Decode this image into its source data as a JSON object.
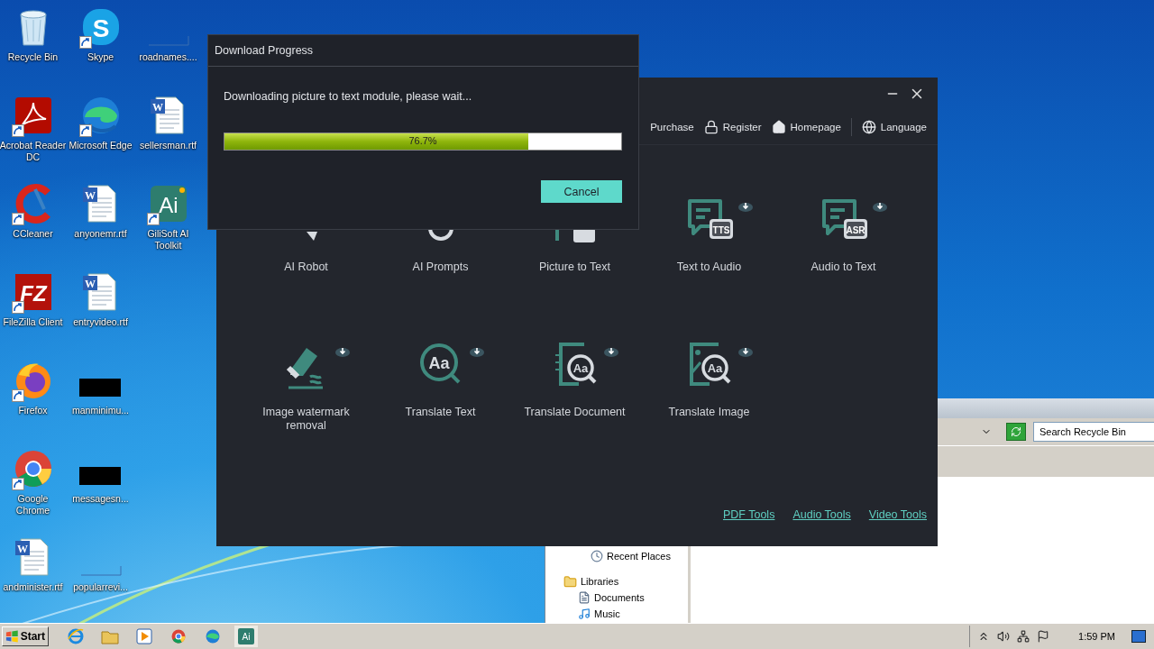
{
  "desktop": {
    "icons": [
      {
        "label": "Recycle Bin",
        "kind": "recycle",
        "shortcut": false
      },
      {
        "label": "Acrobat Reader DC",
        "kind": "acrobat",
        "shortcut": true
      },
      {
        "label": "CCleaner",
        "kind": "ccleaner",
        "shortcut": true
      },
      {
        "label": "FileZilla Client",
        "kind": "filezilla",
        "glyph": "FZ",
        "shortcut": true
      },
      {
        "label": "Firefox",
        "kind": "firefox",
        "shortcut": true
      },
      {
        "label": "Google Chrome",
        "kind": "chrome",
        "shortcut": true
      },
      {
        "label": "andminister.rtf",
        "kind": "word",
        "glyph": "W",
        "shortcut": false
      },
      {
        "label": "Skype",
        "kind": "skype",
        "glyph": "S",
        "shortcut": true
      },
      {
        "label": "Microsoft Edge",
        "kind": "edge",
        "shortcut": true
      },
      {
        "label": "anyonemr.rtf",
        "kind": "word",
        "glyph": "W",
        "shortcut": false
      },
      {
        "label": "entryvideo.rtf",
        "kind": "word",
        "glyph": "W",
        "shortcut": false
      },
      {
        "label": "manminimu...",
        "kind": "redacted",
        "shortcut": false
      },
      {
        "label": "messagesn...",
        "kind": "redacted",
        "shortcut": false
      },
      {
        "label": "popularrevi...",
        "kind": "blank",
        "shortcut": false
      },
      {
        "label": "roadnames....",
        "kind": "blank",
        "shortcut": false
      },
      {
        "label": "sellersman.rtf",
        "kind": "word",
        "glyph": "W",
        "shortcut": false
      },
      {
        "label": "GiliSoft AI Toolkit",
        "kind": "gilisoft",
        "glyph": "Ai",
        "shortcut": true
      }
    ]
  },
  "explorer": {
    "search": {
      "placeholder": "Search Recycle Bin"
    },
    "nav": [
      {
        "label": "Recent Places",
        "kind": "recent"
      },
      {
        "label": "Libraries",
        "kind": "library",
        "children": [
          {
            "label": "Documents",
            "kind": "document"
          },
          {
            "label": "Music",
            "kind": "music"
          }
        ]
      }
    ]
  },
  "app": {
    "nav": [
      {
        "label": "Purchase",
        "kind": "cart"
      },
      {
        "label": "Register",
        "kind": "lock"
      },
      {
        "label": "Homepage",
        "kind": "home"
      },
      {
        "label": "Language",
        "kind": "globe"
      }
    ],
    "tools": [
      {
        "label": "AI Robot",
        "kind": "robot",
        "download": false
      },
      {
        "label": "AI Prompts",
        "kind": "prompts",
        "download": false
      },
      {
        "label": "Picture to Text",
        "kind": "ocr",
        "download": false
      },
      {
        "label": "Text to Audio",
        "kind": "speech",
        "glyph": "TTS",
        "download": true
      },
      {
        "label": "Audio to Text",
        "kind": "speech",
        "glyph": "ASR",
        "download": true
      },
      {
        "label": "Image watermark removal",
        "kind": "eraser",
        "download": true
      },
      {
        "label": "Translate Text",
        "kind": "magnifier",
        "glyph": "Aa",
        "download": true
      },
      {
        "label": "Translate Document",
        "kind": "document",
        "glyph": "Aa",
        "download": true
      },
      {
        "label": "Translate Image",
        "kind": "image",
        "glyph": "Aa",
        "download": true
      }
    ],
    "links": [
      "PDF Tools",
      "Audio Tools",
      "Video Tools"
    ]
  },
  "dialog": {
    "title": "Download Progress",
    "message": "Downloading picture to text module, please wait...",
    "progress": {
      "level": 0.767,
      "label": "76.7%"
    },
    "button": "Cancel"
  },
  "taskbar": {
    "start": "Start",
    "apps": [
      {
        "kind": "ie",
        "selected": false
      },
      {
        "kind": "folder",
        "selected": false
      },
      {
        "kind": "media",
        "selected": false
      },
      {
        "kind": "chrome",
        "selected": false
      },
      {
        "kind": "edge",
        "selected": false
      },
      {
        "kind": "gilisoft",
        "glyph": "Ai",
        "selected": true
      }
    ],
    "time": "1:59 PM"
  }
}
